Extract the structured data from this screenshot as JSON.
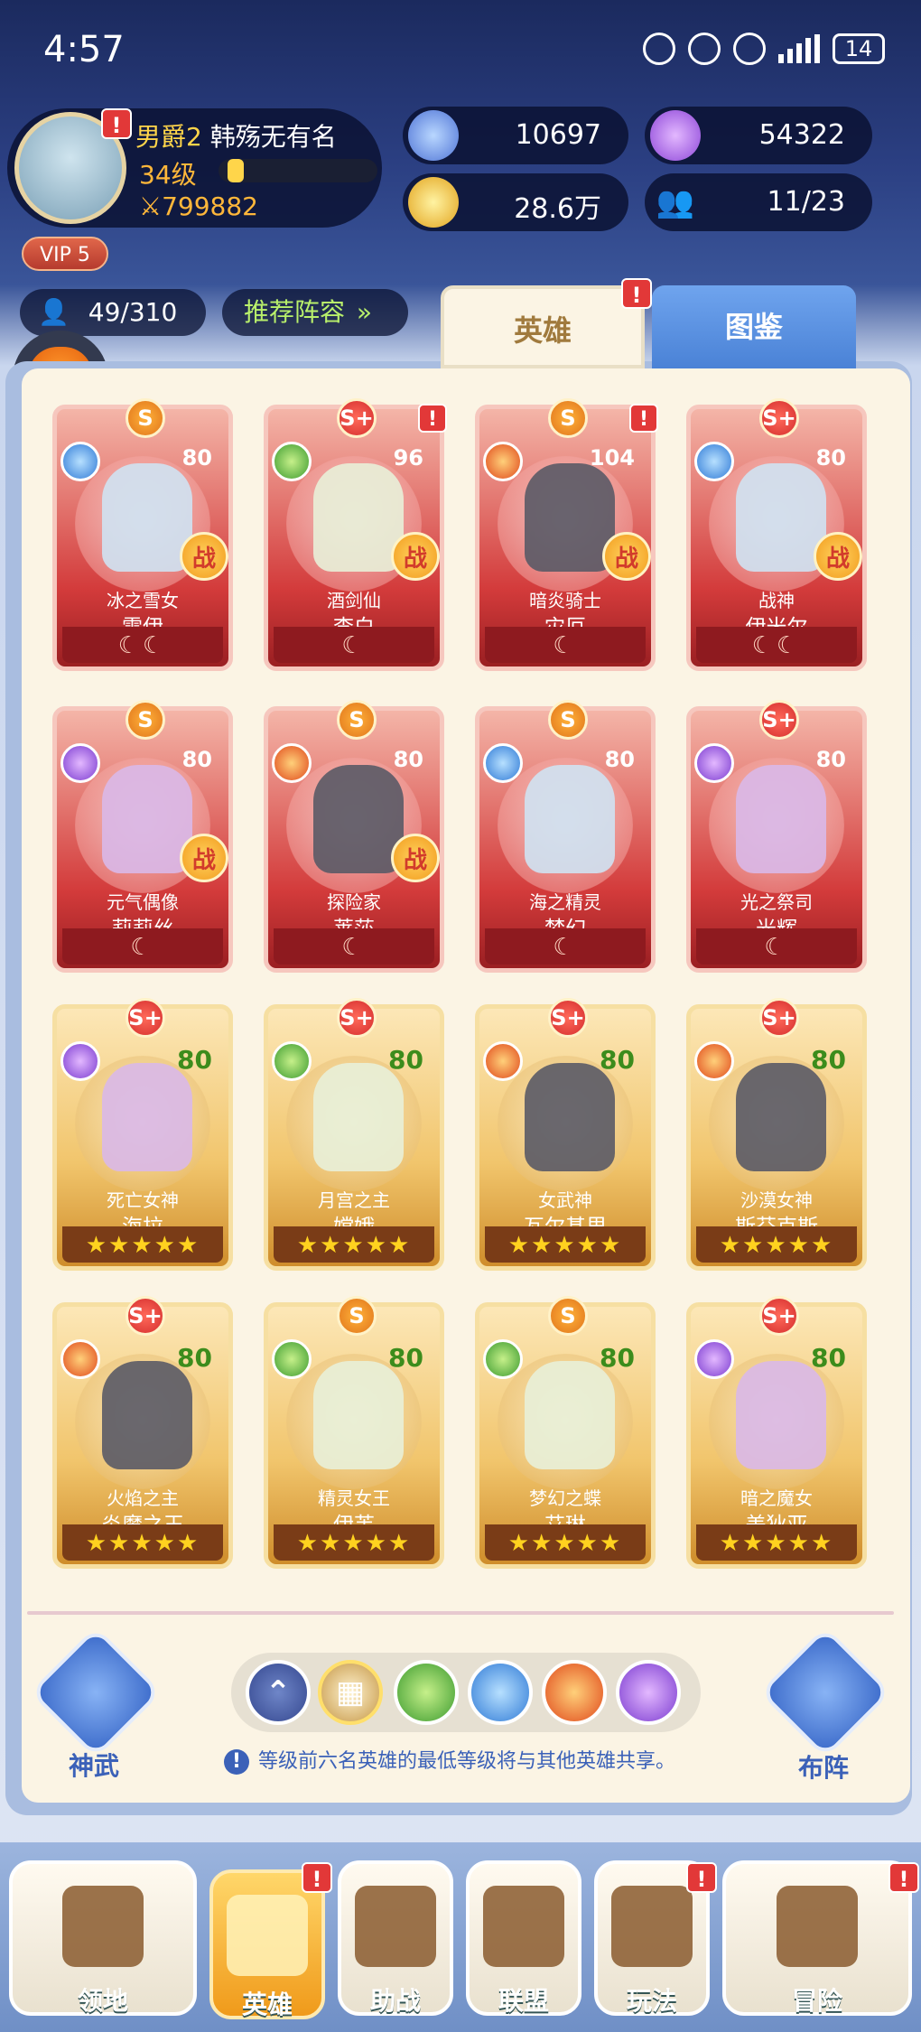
{
  "status_bar": {
    "time": "4:57",
    "battery": "14"
  },
  "player": {
    "rank": "男爵2",
    "name": "韩殇无有名",
    "level": "34级",
    "level_progress": 0.1,
    "power": "799882",
    "vip": "VIP 5"
  },
  "resources": {
    "stars": "10697",
    "gems": "54322",
    "coins": "28.6万",
    "members": "11/23"
  },
  "hero_count": "49/310",
  "recommend_label": "推荐阵容",
  "tabs": {
    "heroes": "英雄",
    "atlas": "图鉴"
  },
  "heroes": [
    {
      "grade": "S",
      "element": "ice",
      "level": "80",
      "title": "冰之雪女",
      "name": "雪伊",
      "rarity": "red",
      "moons": "☾☾",
      "war": "战",
      "alert": false
    },
    {
      "grade": "S+",
      "element": "wood",
      "level": "96",
      "title": "酒剑仙",
      "name": "李白",
      "rarity": "red",
      "moons": "☾",
      "war": "战",
      "alert": true
    },
    {
      "grade": "S",
      "element": "fire",
      "level": "104",
      "title": "暗炎骑士",
      "name": "灾厄",
      "rarity": "red",
      "moons": "☾",
      "war": "战",
      "alert": true
    },
    {
      "grade": "S+",
      "element": "ice",
      "level": "80",
      "title": "战神",
      "name": "伊米尔",
      "rarity": "red",
      "moons": "☾☾",
      "war": "战",
      "alert": false
    },
    {
      "grade": "S",
      "element": "arcane",
      "level": "80",
      "title": "元气偶像",
      "name": "莉莉丝",
      "rarity": "red",
      "moons": "☾",
      "war": "战",
      "alert": false
    },
    {
      "grade": "S",
      "element": "fire",
      "level": "80",
      "title": "探险家",
      "name": "莱莎",
      "rarity": "red",
      "moons": "☾",
      "war": "战",
      "alert": false
    },
    {
      "grade": "S",
      "element": "ice",
      "level": "80",
      "title": "海之精灵",
      "name": "梦幻",
      "rarity": "red",
      "moons": "☾",
      "war": "",
      "alert": false
    },
    {
      "grade": "S+",
      "element": "arcane",
      "level": "80",
      "title": "光之祭司",
      "name": "光辉",
      "rarity": "red",
      "moons": "☾",
      "war": "",
      "alert": false
    },
    {
      "grade": "S+",
      "element": "arcane",
      "level": "80",
      "title": "死亡女神",
      "name": "海拉",
      "rarity": "gold",
      "stars": "★★★★★",
      "war": "",
      "alert": false
    },
    {
      "grade": "S+",
      "element": "wood",
      "level": "80",
      "title": "月宫之主",
      "name": "嫦娥",
      "rarity": "gold",
      "stars": "★★★★★",
      "war": "",
      "alert": false
    },
    {
      "grade": "S+",
      "element": "fire",
      "level": "80",
      "title": "女武神",
      "name": "瓦尔基里",
      "rarity": "gold",
      "stars": "★★★★★",
      "war": "",
      "alert": false
    },
    {
      "grade": "S+",
      "element": "fire",
      "level": "80",
      "title": "沙漠女神",
      "name": "斯芬克斯",
      "rarity": "gold",
      "stars": "★★★★★",
      "war": "",
      "alert": false
    },
    {
      "grade": "S+",
      "element": "fire",
      "level": "80",
      "title": "火焰之主",
      "name": "炎魔之王",
      "rarity": "gold",
      "stars": "★★★★★",
      "war": "",
      "alert": false
    },
    {
      "grade": "S",
      "element": "wood",
      "level": "80",
      "title": "精灵女王",
      "name": "伊芙",
      "rarity": "gold",
      "stars": "★★★★★",
      "war": "",
      "alert": false
    },
    {
      "grade": "S",
      "element": "wood",
      "level": "80",
      "title": "梦幻之蝶",
      "name": "艾琳",
      "rarity": "gold",
      "stars": "★★★★★",
      "war": "",
      "alert": false
    },
    {
      "grade": "S+",
      "element": "arcane",
      "level": "80",
      "title": "暗之魔女",
      "name": "美狄亚",
      "rarity": "gold",
      "stars": "★★★★★",
      "war": "",
      "alert": false
    }
  ],
  "controls": {
    "shenwu": "神武",
    "buzhen": "布阵",
    "tip": "等级前六名英雄的最低等级将与其他英雄共享。"
  },
  "nav": [
    {
      "label": "领地",
      "alert": false,
      "active": false
    },
    {
      "label": "英雄",
      "alert": true,
      "active": true
    },
    {
      "label": "助战",
      "alert": false,
      "active": false
    },
    {
      "label": "联盟",
      "alert": false,
      "active": false
    },
    {
      "label": "玩法",
      "alert": true,
      "active": false
    },
    {
      "label": "冒险",
      "alert": true,
      "active": false
    }
  ]
}
